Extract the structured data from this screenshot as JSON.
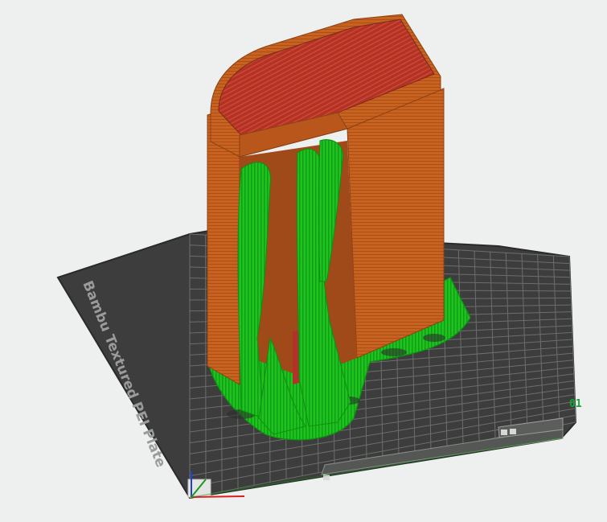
{
  "viewport": {
    "plate_label": "Bambu Textured PEI Plate",
    "plate_number": "01",
    "colors": {
      "background": "#eef0ef",
      "plate": "#3c3d3c",
      "plate_edge": "#2a2a2a",
      "grid": "#7d7f7d",
      "model_wall": "#c8621e",
      "model_wall_dark": "#a8501a",
      "model_top": "#b2322a",
      "support": "#1fc21f",
      "support_dark": "#0f8f12",
      "plate_number": "#14a83a",
      "axis_x": "#d92020",
      "axis_y": "#1a9a1a",
      "axis_z": "#2040d0"
    },
    "icons": [
      "axis-gizmo-icon",
      "plate-settings-icon",
      "plate-lock-icon"
    ]
  }
}
